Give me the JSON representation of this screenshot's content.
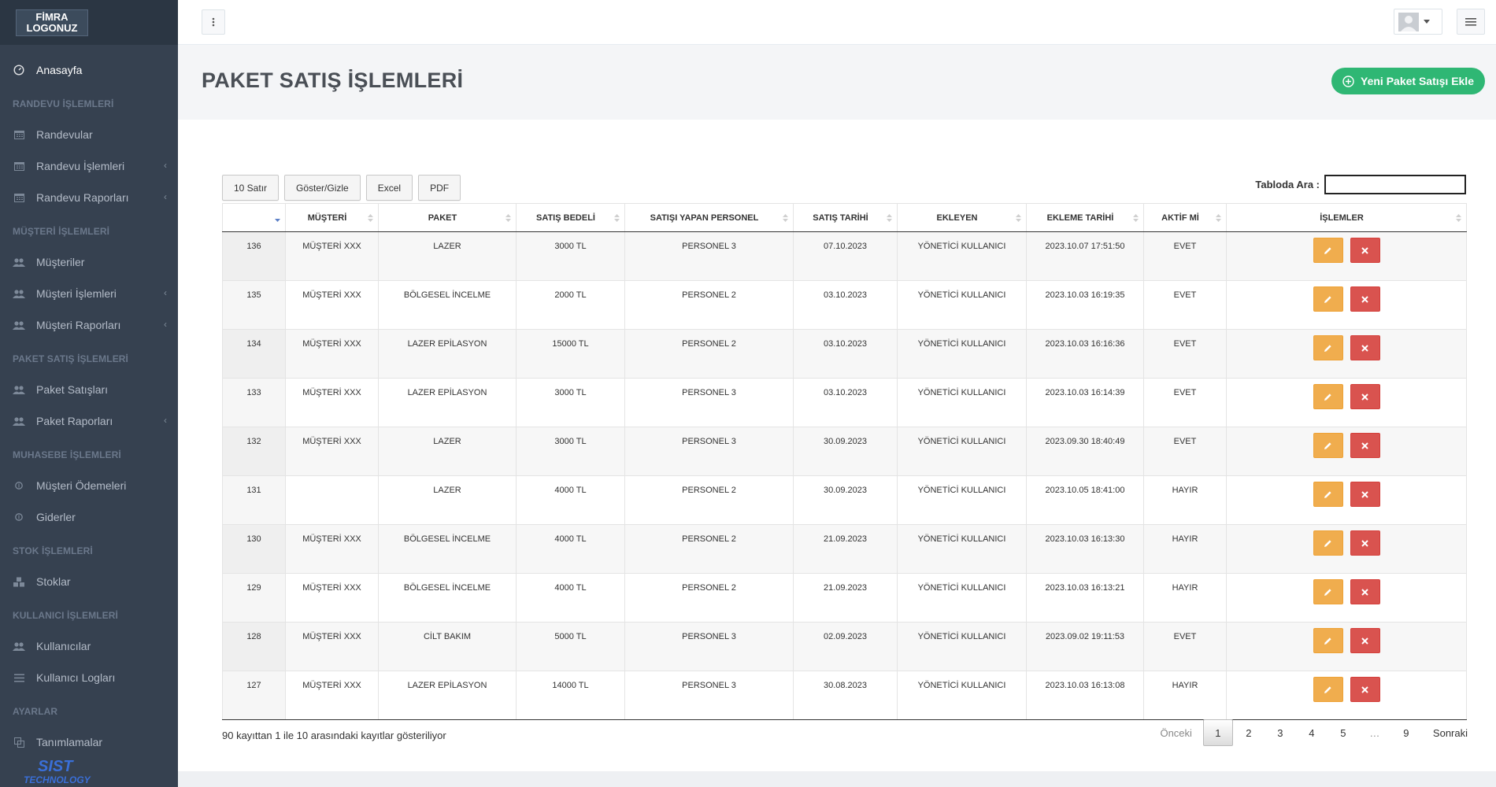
{
  "brand": {
    "logo_line1": "FİMRA",
    "logo_line2": "LOGONUZ",
    "bottom_logo_line1": "SIST",
    "bottom_logo_line2": "TECHNOLOGY"
  },
  "sidebar": {
    "home": {
      "label": "Anasayfa",
      "icon": "dashboard-icon"
    },
    "sections": [
      {
        "heading": "RANDEVU İŞLEMLERİ",
        "items": [
          {
            "label": "Randevular",
            "icon": "calendar-icon",
            "chevron": false
          },
          {
            "label": "Randevu İşlemleri",
            "icon": "calendar-icon",
            "chevron": true
          },
          {
            "label": "Randevu Raporları",
            "icon": "calendar-icon",
            "chevron": true
          }
        ]
      },
      {
        "heading": "MÜŞTERİ İŞLEMLERİ",
        "items": [
          {
            "label": "Müşteriler",
            "icon": "users-icon",
            "chevron": false
          },
          {
            "label": "Müşteri İşlemleri",
            "icon": "users-icon",
            "chevron": true
          },
          {
            "label": "Müşteri Raporları",
            "icon": "users-icon",
            "chevron": true
          }
        ]
      },
      {
        "heading": "PAKET SATIŞ İŞLEMLERİ",
        "items": [
          {
            "label": "Paket Satışları",
            "icon": "users-icon",
            "chevron": false
          },
          {
            "label": "Paket Raporları",
            "icon": "users-icon",
            "chevron": true
          }
        ]
      },
      {
        "heading": "MUHASEBE İŞLEMLERİ",
        "items": [
          {
            "label": "Müşteri Ödemeleri",
            "icon": "coin-icon",
            "chevron": false
          },
          {
            "label": "Giderler",
            "icon": "coin-icon",
            "chevron": false
          }
        ]
      },
      {
        "heading": "STOK İŞLEMLERİ",
        "items": [
          {
            "label": "Stoklar",
            "icon": "cubes-icon",
            "chevron": false
          }
        ]
      },
      {
        "heading": "KULLANICI İŞLEMLERİ",
        "items": [
          {
            "label": "Kullanıcılar",
            "icon": "users-icon",
            "chevron": false
          },
          {
            "label": "Kullanıcı Logları",
            "icon": "list-icon",
            "chevron": false
          }
        ]
      },
      {
        "heading": "AYARLAR",
        "items": [
          {
            "label": "Tanımlamalar",
            "icon": "copy-icon",
            "chevron": false
          }
        ]
      }
    ]
  },
  "page": {
    "title": "PAKET SATIŞ İŞLEMLERİ",
    "add_button_label": "Yeni Paket Satışı Ekle"
  },
  "toolbar": {
    "rows_label": "10 Satır",
    "toggle_label": "Göster/Gizle",
    "excel_label": "Excel",
    "pdf_label": "PDF",
    "search_label": "Tabloda Ara :",
    "search_value": ""
  },
  "table": {
    "columns": [
      "",
      "MÜŞTERİ",
      "PAKET",
      "SATIŞ BEDELİ",
      "SATIŞI YAPAN PERSONEL",
      "SATIŞ TARİHİ",
      "EKLEYEN",
      "EKLEME TARİHİ",
      "AKTİF Mİ",
      "İŞLEMLER"
    ],
    "rows": [
      [
        "136",
        "MÜŞTERİ XXX",
        "LAZER",
        "3000 TL",
        "PERSONEL 3",
        "07.10.2023",
        "YÖNETİCİ KULLANICI",
        "2023.10.07 17:51:50",
        "EVET"
      ],
      [
        "135",
        "MÜŞTERİ XXX",
        "BÖLGESEL İNCELME",
        "2000 TL",
        "PERSONEL 2",
        "03.10.2023",
        "YÖNETİCİ KULLANICI",
        "2023.10.03 16:19:35",
        "EVET"
      ],
      [
        "134",
        "MÜŞTERİ XXX",
        "LAZER EPİLASYON",
        "15000 TL",
        "PERSONEL 2",
        "03.10.2023",
        "YÖNETİCİ KULLANICI",
        "2023.10.03 16:16:36",
        "EVET"
      ],
      [
        "133",
        "MÜŞTERİ XXX",
        "LAZER EPİLASYON",
        "3000 TL",
        "PERSONEL 3",
        "03.10.2023",
        "YÖNETİCİ KULLANICI",
        "2023.10.03 16:14:39",
        "EVET"
      ],
      [
        "132",
        "MÜŞTERİ XXX",
        "LAZER",
        "3000 TL",
        "PERSONEL 3",
        "30.09.2023",
        "YÖNETİCİ KULLANICI",
        "2023.09.30 18:40:49",
        "EVET"
      ],
      [
        "131",
        "",
        "LAZER",
        "4000 TL",
        "PERSONEL 2",
        "30.09.2023",
        "YÖNETİCİ KULLANICI",
        "2023.10.05 18:41:00",
        "HAYIR"
      ],
      [
        "130",
        "MÜŞTERİ XXX",
        "BÖLGESEL İNCELME",
        "4000 TL",
        "PERSONEL 2",
        "21.09.2023",
        "YÖNETİCİ KULLANICI",
        "2023.10.03 16:13:30",
        "HAYIR"
      ],
      [
        "129",
        "MÜŞTERİ XXX",
        "BÖLGESEL İNCELME",
        "4000 TL",
        "PERSONEL 2",
        "21.09.2023",
        "YÖNETİCİ KULLANICI",
        "2023.10.03 16:13:21",
        "HAYIR"
      ],
      [
        "128",
        "MÜŞTERİ XXX",
        "CİLT BAKIM",
        "5000 TL",
        "PERSONEL 3",
        "02.09.2023",
        "YÖNETİCİ KULLANICI",
        "2023.09.02 19:11:53",
        "EVET"
      ],
      [
        "127",
        "MÜŞTERİ XXX",
        "LAZER EPİLASYON",
        "14000 TL",
        "PERSONEL 3",
        "30.08.2023",
        "YÖNETİCİ KULLANICI",
        "2023.10.03 16:13:08",
        "HAYIR"
      ]
    ],
    "sorted_column": 0,
    "sort_direction": "descending"
  },
  "footer": {
    "info": "90 kayıttan 1 ile 10 arasındaki kayıtlar gösteriliyor",
    "prev": "Önceki",
    "pages": [
      "1",
      "2",
      "3",
      "4",
      "5",
      "…",
      "9"
    ],
    "current_page": "1",
    "next": "Sonraki"
  },
  "colors": {
    "sidebar": "#364150",
    "accent_green": "#2fb774",
    "edit": "#f0ad4e",
    "delete": "#d9534f"
  }
}
